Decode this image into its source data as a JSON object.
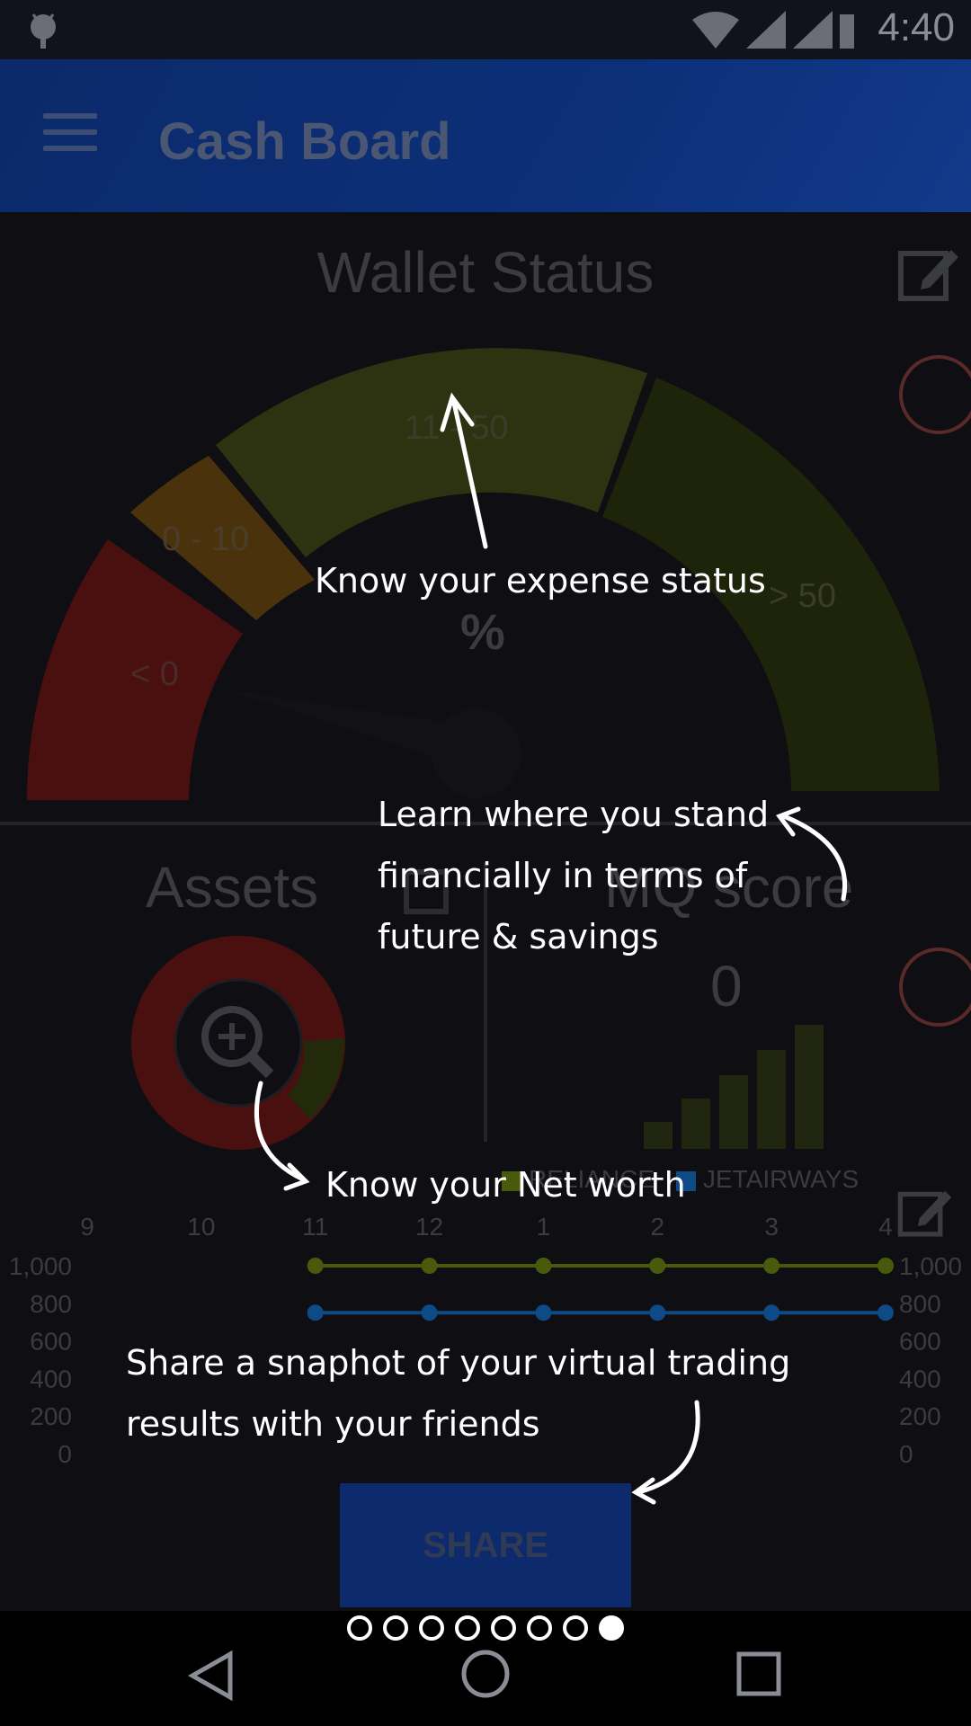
{
  "status_bar": {
    "time": "4:40"
  },
  "app_bar": {
    "title": "Cash Board"
  },
  "wallet": {
    "title": "Wallet Status",
    "gauge": {
      "segments": [
        "< 0",
        "0 - 10",
        "11 - 50",
        "> 50"
      ],
      "unit": "%"
    }
  },
  "assets": {
    "title": "Assets"
  },
  "mq_score": {
    "title": "MQ score",
    "value": "0"
  },
  "legend": {
    "series1": "RELIANCE",
    "series2": "JETAIRWAYS",
    "series1_color": "#4a5a0c",
    "series2_color": "#0d4a86"
  },
  "chart_data": {
    "type": "line",
    "x": [
      "9",
      "10",
      "11",
      "12",
      "1",
      "2",
      "3",
      "4"
    ],
    "ylim": [
      0,
      1000
    ],
    "y_ticks_left": [
      "1,000",
      "800",
      "600",
      "400",
      "200",
      "0"
    ],
    "y_ticks_right": [
      "1,000",
      "800",
      "600",
      "400",
      "200",
      "0"
    ],
    "series": [
      {
        "name": "RELIANCE",
        "x": [
          "11",
          "12",
          "1",
          "2",
          "3",
          "4"
        ],
        "values": [
          1000,
          1000,
          1000,
          1000,
          1000,
          1000
        ],
        "color": "#4a5a0c"
      },
      {
        "name": "JETAIRWAYS",
        "x": [
          "11",
          "12",
          "1",
          "2",
          "3",
          "4"
        ],
        "values": [
          750,
          750,
          750,
          750,
          750,
          750
        ],
        "color": "#0d4a86"
      }
    ]
  },
  "share": {
    "label": "SHARE"
  },
  "hints": {
    "expense": "Know your expense status",
    "stand_1": "Learn where you stand",
    "stand_2": "financially in terms of",
    "stand_3": "future & savings",
    "networth": "Know your Net worth",
    "share_1": "Share a snaphot of your virtual trading",
    "share_2": "results with your friends"
  },
  "pager": {
    "count": 8,
    "active": 7
  }
}
